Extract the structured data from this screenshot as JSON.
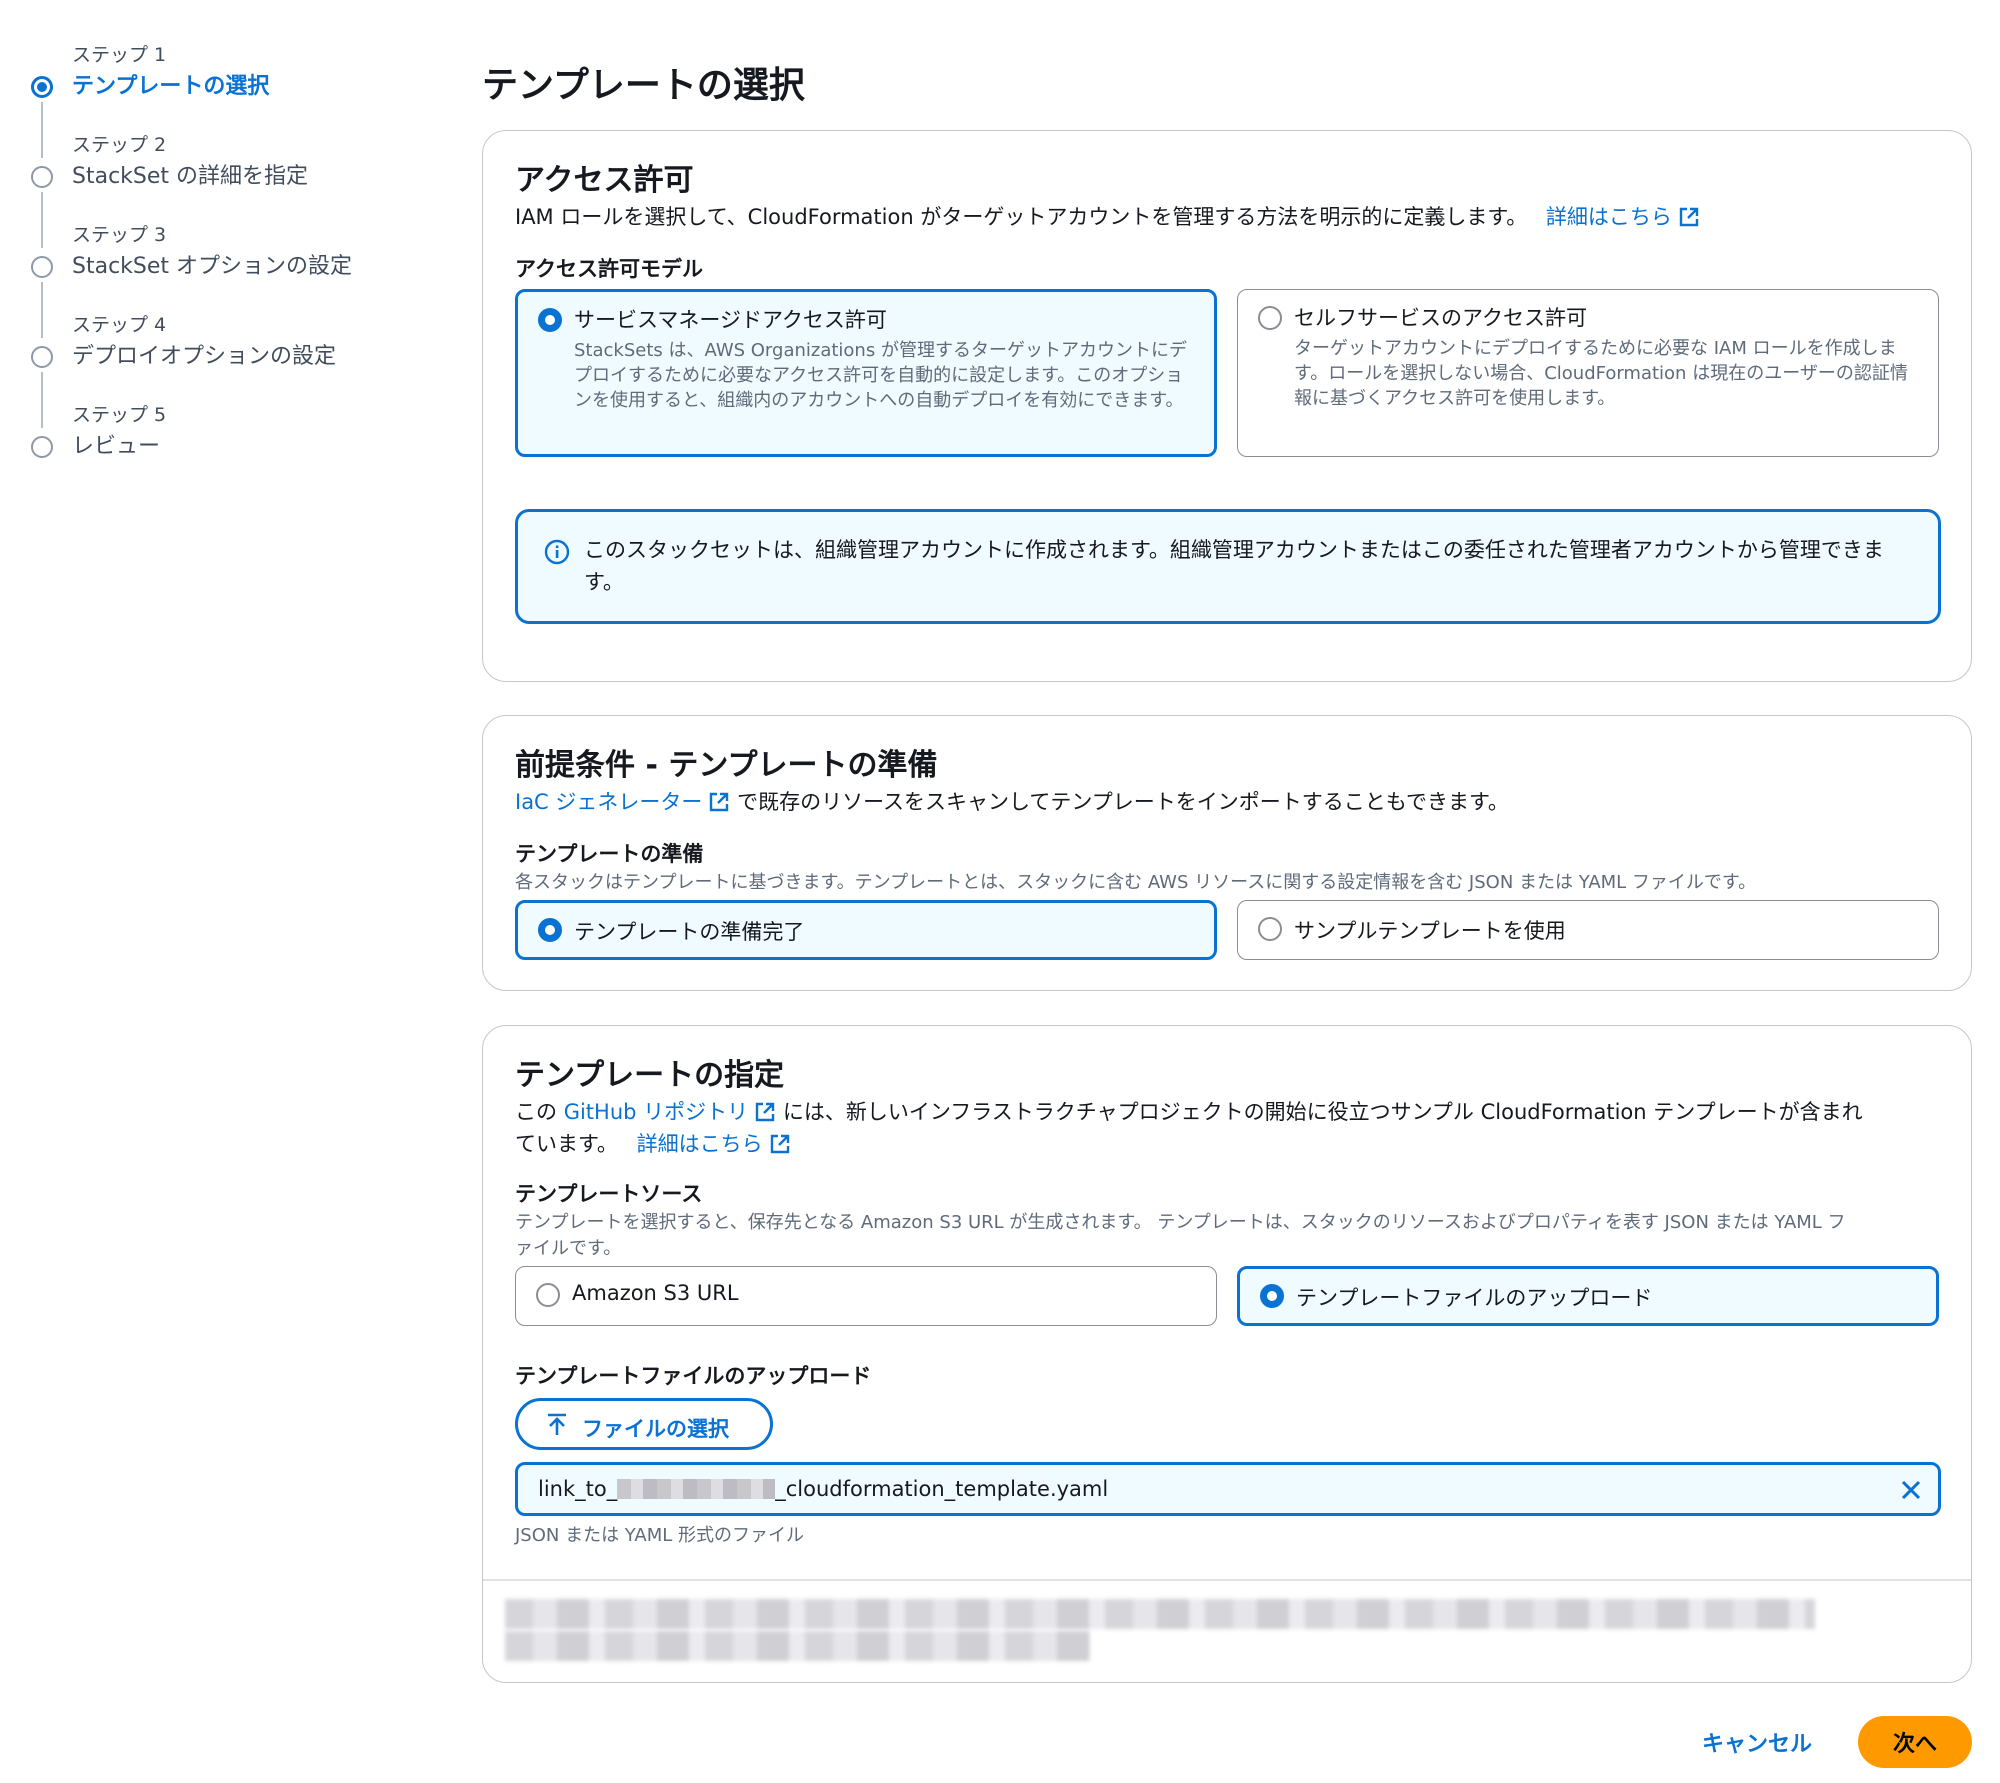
{
  "steps": [
    {
      "num": "ステップ 1",
      "label": "テンプレートの選択",
      "active": true
    },
    {
      "num": "ステップ 2",
      "label": "StackSet の詳細を指定",
      "active": false
    },
    {
      "num": "ステップ 3",
      "label": "StackSet オプションの設定",
      "active": false
    },
    {
      "num": "ステップ 4",
      "label": "デプロイオプションの設定",
      "active": false
    },
    {
      "num": "ステップ 5",
      "label": "レビュー",
      "active": false
    }
  ],
  "page_title": "テンプレートの選択",
  "access": {
    "title": "アクセス許可",
    "description": "IAM ロールを選択して、CloudFormation がターゲットアカウントを管理する方法を明示的に定義します。",
    "learn_more": "詳細はこちら",
    "model_label": "アクセス許可モデル",
    "options": [
      {
        "label": "サービスマネージドアクセス許可",
        "desc": "StackSets は、AWS Organizations が管理するターゲットアカウントにデプロイするために必要なアクセス許可を自動的に設定します。このオプションを使用すると、組織内のアカウントへの自動デプロイを有効にできます。",
        "selected": true
      },
      {
        "label": "セルフサービスのアクセス許可",
        "desc": "ターゲットアカウントにデプロイするために必要な IAM ロールを作成します。ロールを選択しない場合、CloudFormation は現在のユーザーの認証情報に基づくアクセス許可を使用します。",
        "selected": false
      }
    ],
    "alert": "このスタックセットは、組織管理アカウントに作成されます。組織管理アカウントまたはこの委任された管理者アカウントから管理できます。"
  },
  "prereq": {
    "title": "前提条件 - テンプレートの準備",
    "iac_link": "IaC ジェネレーター",
    "iac_text": "で既存のリソースをスキャンしてテンプレートをインポートすることもできます。",
    "field_label": "テンプレートの準備",
    "field_desc": "各スタックはテンプレートに基づきます。テンプレートとは、スタックに含む AWS リソースに関する設定情報を含む JSON または YAML ファイルです。",
    "options": [
      {
        "label": "テンプレートの準備完了",
        "selected": true
      },
      {
        "label": "サンプルテンプレートを使用",
        "selected": false
      }
    ]
  },
  "specify": {
    "title": "テンプレートの指定",
    "desc_prefix": "この",
    "github_link": "GitHub リポジトリ",
    "desc_middle": "には、新しいインフラストラクチャプロジェクトの開始に役立つサンプル CloudFormation テンプレートが含まれ",
    "desc_line2": "ています。",
    "learn_more": "詳細はこちら",
    "source_label": "テンプレートソース",
    "source_desc_1": "テンプレートを選択すると、保存先となる Amazon S3 URL が生成されます。 テンプレートは、スタックのリソースおよびプロパティを表す JSON または YAML フ",
    "source_desc_2": "ァイルです。",
    "options": [
      {
        "label": "Amazon S3 URL",
        "selected": false
      },
      {
        "label": "テンプレートファイルのアップロード",
        "selected": true
      }
    ],
    "upload_label": "テンプレートファイルのアップロード",
    "upload_button": "ファイルの選択",
    "file_prefix": "link_to_",
    "file_suffix": "_cloudformation_template.yaml",
    "file_hint": "JSON または YAML 形式のファイル"
  },
  "footer": {
    "cancel": "キャンセル",
    "next": "次へ"
  },
  "colors": {
    "accent": "#0972d3",
    "primary_button": "#ff9900",
    "selected_tile_bg": "#f0fbff"
  }
}
